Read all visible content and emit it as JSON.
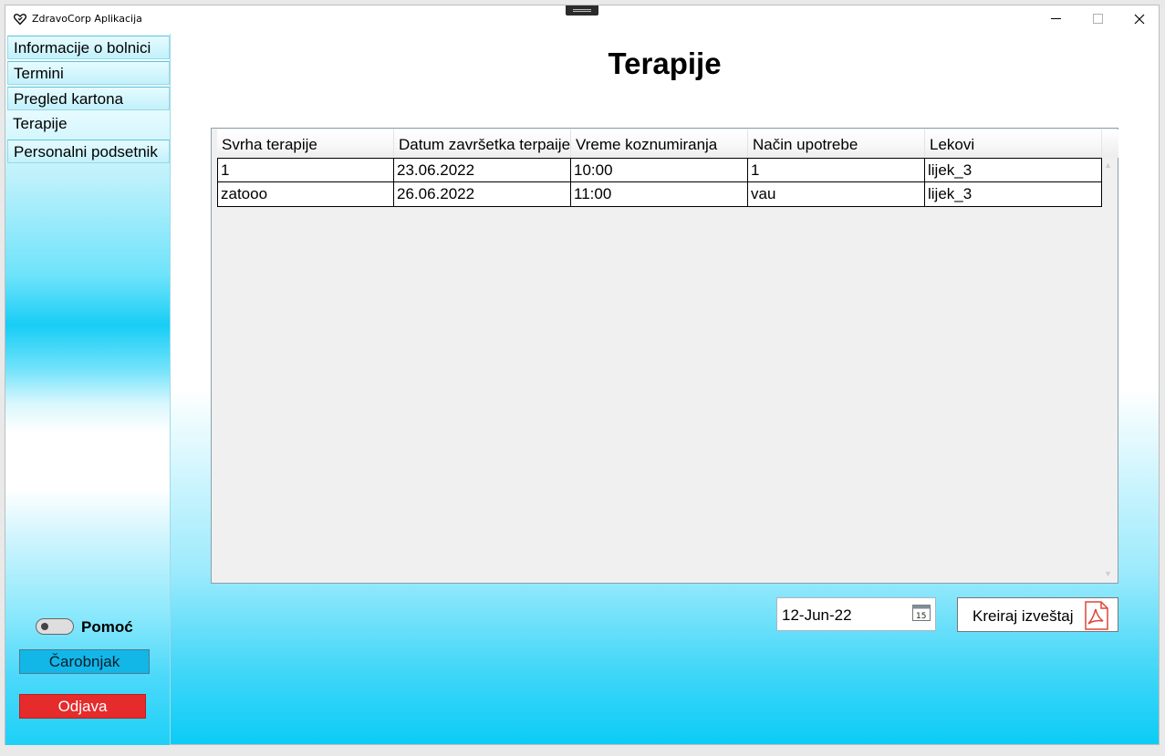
{
  "window": {
    "title": "ZdravoCorp Aplikacija",
    "icons": {
      "app": "heart-shield-icon",
      "minimize": "minimize-icon",
      "maximize": "maximize-icon",
      "close": "close-icon"
    }
  },
  "sidebar": {
    "items": [
      {
        "label": "Informacije o bolnici",
        "active": false
      },
      {
        "label": "Termini",
        "active": false
      },
      {
        "label": "Pregled kartona",
        "active": false
      },
      {
        "label": "Terapije",
        "active": true
      },
      {
        "label": "Personalni podsetnik",
        "active": false
      }
    ],
    "help_toggle": {
      "label": "Pomoć",
      "on": false
    },
    "wizard_label": "Čarobnjak",
    "logout_label": "Odjava"
  },
  "main": {
    "title": "Terapije",
    "table": {
      "columns": [
        "Svrha terapije",
        "Datum završetka terpaije",
        "Vreme koznumiranja",
        "Način upotrebe",
        "Lekovi"
      ],
      "rows": [
        [
          "1",
          "23.06.2022",
          "10:00",
          "1",
          "lijek_3"
        ],
        [
          "zatooo",
          "26.06.2022",
          "11:00",
          "vau",
          "lijek_3"
        ]
      ]
    },
    "date_picker": {
      "value": "12-Jun-22",
      "icon": "calendar-icon",
      "calendar_day": "15"
    },
    "report_button": {
      "label": "Kreiraj izveštaj",
      "icon": "pdf-icon"
    }
  },
  "colors": {
    "accent_cyan": "#12b7e8",
    "logout_red": "#e52b2b",
    "gradient_cyan": "#0cccf6"
  }
}
